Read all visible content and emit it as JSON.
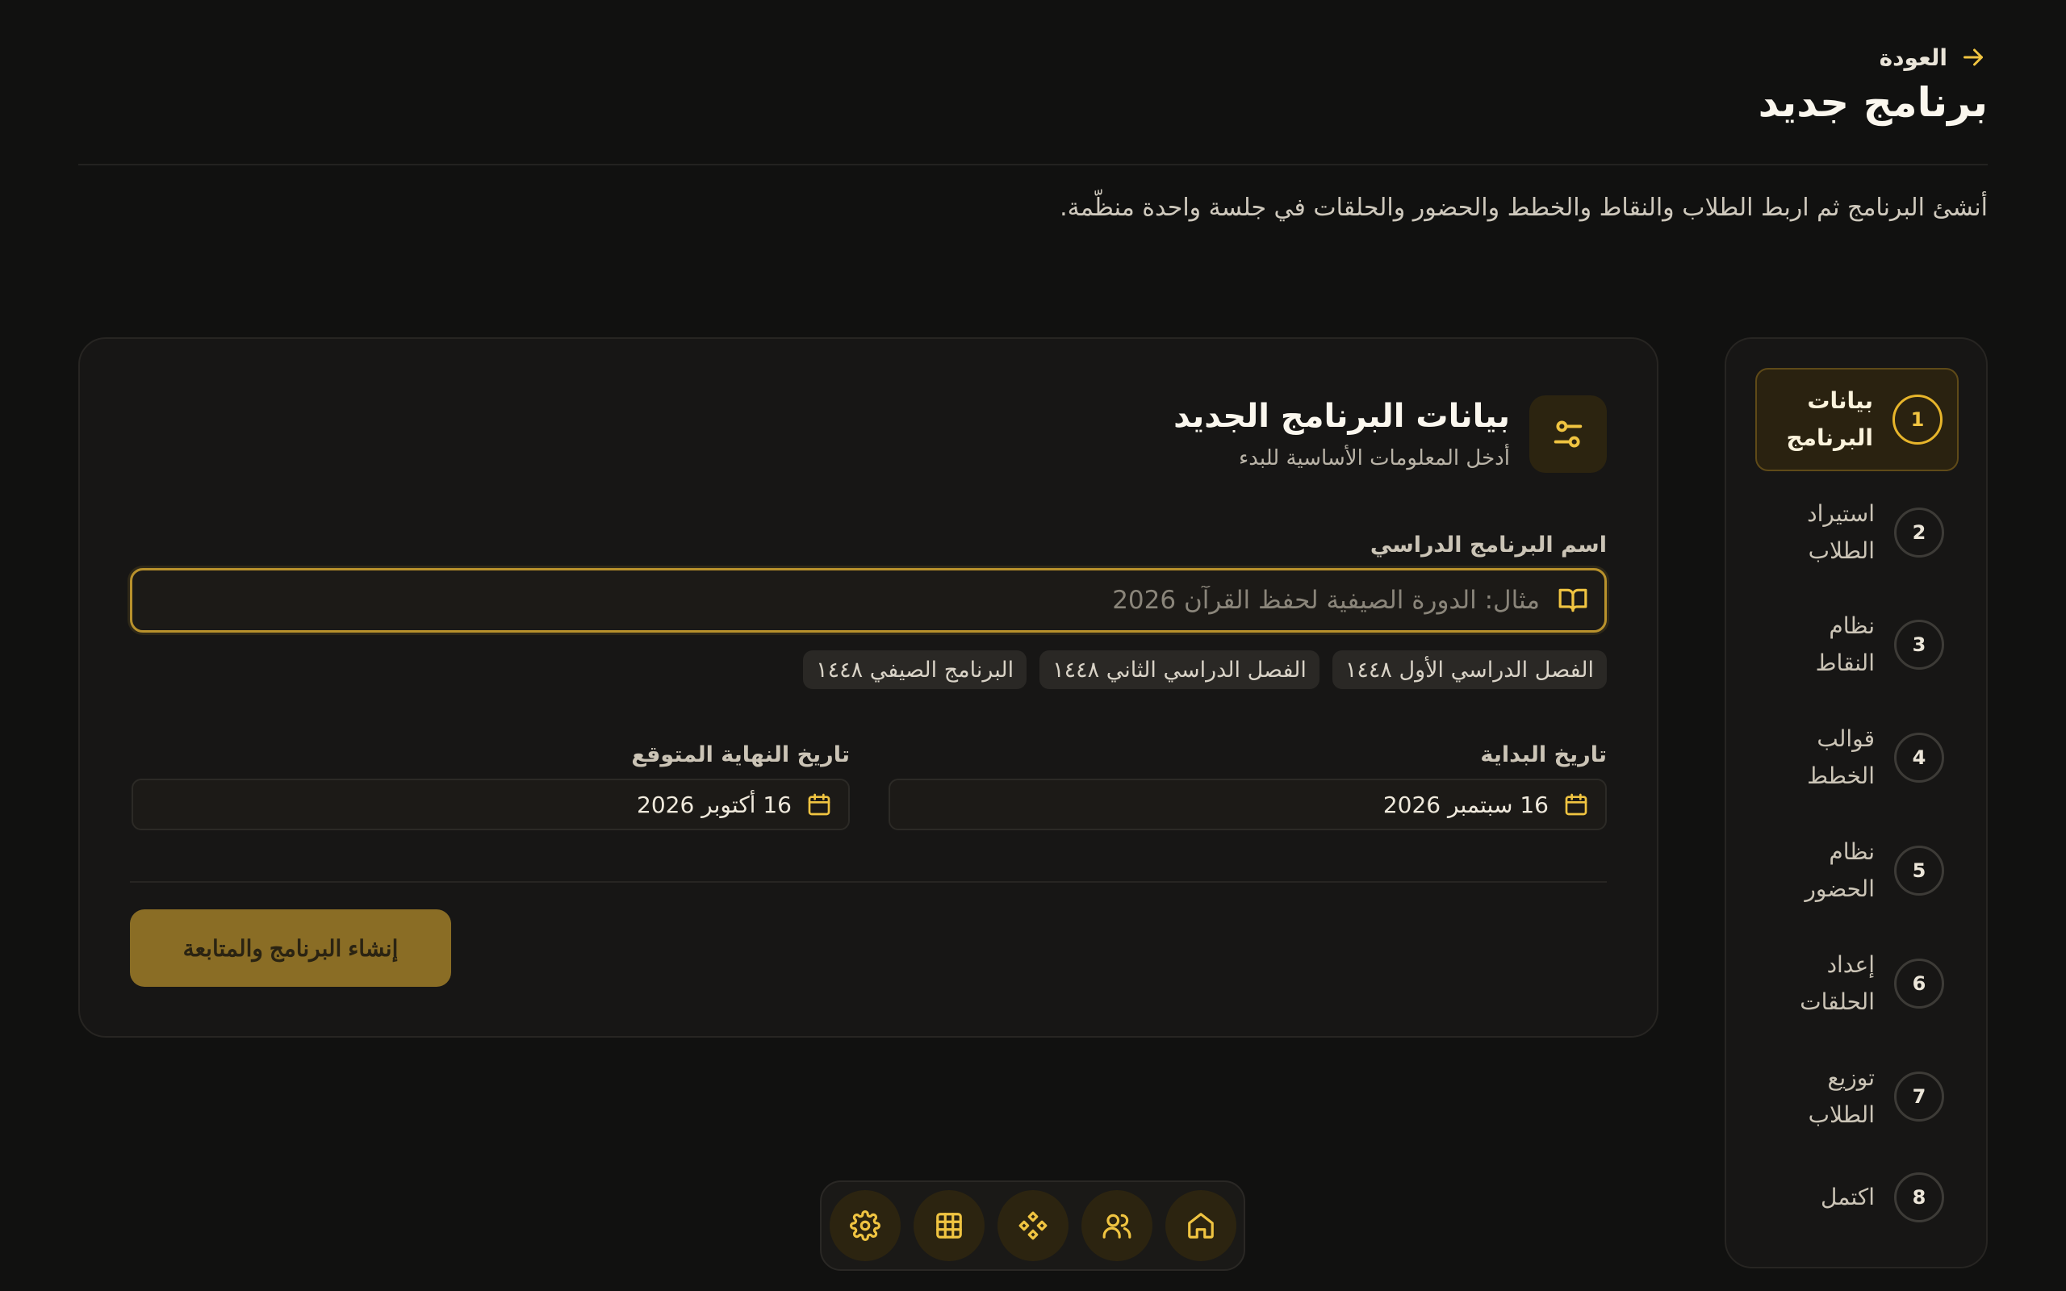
{
  "colors": {
    "background": "#111110",
    "accent": "#f0c441",
    "primary_button": "#8a6d25",
    "card": "#171615"
  },
  "header": {
    "back_label": "العودة",
    "title": "برنامج جديد",
    "description": "أنشئ البرنامج ثم اربط الطلاب والنقاط والخطط والحضور والحلقات في جلسة واحدة منظّمة."
  },
  "form": {
    "title": "بيانات البرنامج الجديد",
    "subtitle": "أدخل المعلومات الأساسية للبدء",
    "name_label": "اسم البرنامج الدراسي",
    "name_value": "",
    "name_placeholder": "مثال: الدورة الصيفية لحفظ القرآن 2026",
    "suggestions": [
      "الفصل الدراسي الأول ١٤٤٨",
      "الفصل الدراسي الثاني ١٤٤٨",
      "البرنامج الصيفي ١٤٤٨"
    ],
    "start_label": "تاريخ البداية",
    "start_value": "16 سبتمبر 2026",
    "end_label": "تاريخ النهاية المتوقع",
    "end_value": "16 أكتوبر 2026",
    "submit_label": "إنشاء البرنامج والمتابعة"
  },
  "steps": [
    {
      "number": "1",
      "label": "بيانات البرنامج",
      "active": true
    },
    {
      "number": "2",
      "label": "استيراد الطلاب",
      "active": false
    },
    {
      "number": "3",
      "label": "نظام النقاط",
      "active": false
    },
    {
      "number": "4",
      "label": "قوالب الخطط",
      "active": false
    },
    {
      "number": "5",
      "label": "نظام الحضور",
      "active": false
    },
    {
      "number": "6",
      "label": "إعداد الحلقات",
      "active": false
    },
    {
      "number": "7",
      "label": "توزيع الطلاب",
      "active": false
    },
    {
      "number": "8",
      "label": "اكتمل",
      "active": false
    }
  ],
  "dock": [
    "home-icon",
    "users-icon",
    "shapes-icon",
    "grid-icon",
    "settings-icon"
  ]
}
